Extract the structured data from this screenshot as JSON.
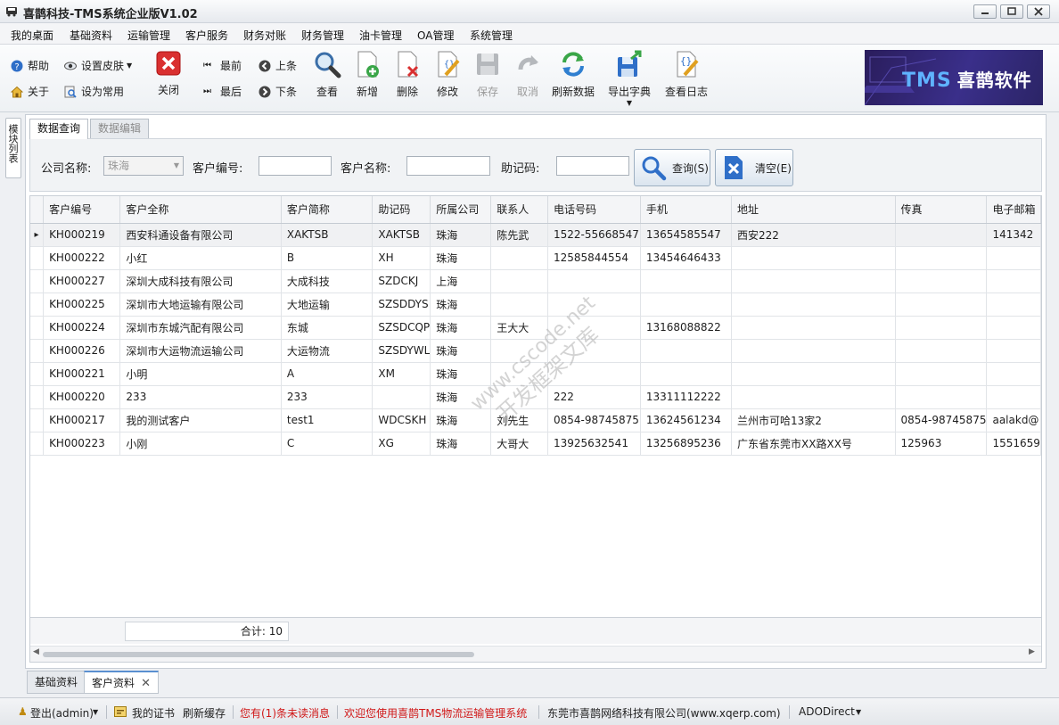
{
  "window": {
    "title": "喜鹊科技-TMS系统企业版V1.02"
  },
  "menu": [
    "我的桌面",
    "基础资料",
    "运输管理",
    "客户服务",
    "财务对账",
    "财务管理",
    "油卡管理",
    "OA管理",
    "系统管理"
  ],
  "toolbar": {
    "help": "帮助",
    "skin": "设置皮肤",
    "about": "关于",
    "set_common": "设为常用",
    "close": "关闭",
    "first": "最前",
    "prev": "上条",
    "last": "最后",
    "next": "下条",
    "view": "查看",
    "add": "新增",
    "delete": "删除",
    "edit": "修改",
    "save": "保存",
    "cancel": "取消",
    "refresh": "刷新数据",
    "export_dict": "导出字典",
    "view_log": "查看日志"
  },
  "banner": {
    "tms": "TMS",
    "text": "喜鹊软件"
  },
  "side_tab": "模块列表",
  "tabs": {
    "query": "数据查询",
    "edit": "数据编辑"
  },
  "filter": {
    "company_label": "公司名称:",
    "company_value": "珠海",
    "code_label": "客户编号:",
    "code_value": "",
    "name_label": "客户名称:",
    "name_value": "",
    "mnemonic_label": "助记码:",
    "mnemonic_value": "",
    "query_btn": "查询(S)",
    "clear_btn": "清空(E)"
  },
  "grid": {
    "columns": [
      "客户编号",
      "客户全称",
      "客户简称",
      "助记码",
      "所属公司",
      "联系人",
      "电话号码",
      "手机",
      "地址",
      "传真",
      "电子邮箱"
    ],
    "rows": [
      [
        "KH000219",
        "西安科通设备有限公司",
        "XAKTSB",
        "XAKTSB",
        "珠海",
        "陈先武",
        "1522-55668547",
        "13654585547",
        "西安222",
        "",
        "141342"
      ],
      [
        "KH000222",
        "小红",
        "B",
        "XH",
        "珠海",
        "",
        "12585844554",
        "13454646433",
        "",
        "",
        ""
      ],
      [
        "KH000227",
        "深圳大成科技有限公司",
        "大成科技",
        "SZDCKJ",
        "上海",
        "",
        "",
        "",
        "",
        "",
        ""
      ],
      [
        "KH000225",
        "深圳市大地运输有限公司",
        "大地运输",
        "SZSDDYS",
        "珠海",
        "",
        "",
        "",
        "",
        "",
        ""
      ],
      [
        "KH000224",
        "深圳市东城汽配有限公司",
        "东城",
        "SZSDCQP",
        "珠海",
        "王大大",
        "",
        "13168088822",
        "",
        "",
        ""
      ],
      [
        "KH000226",
        "深圳市大运物流运输公司",
        "大运物流",
        "SZSDYWL",
        "珠海",
        "",
        "",
        "",
        "",
        "",
        ""
      ],
      [
        "KH000221",
        "小明",
        "A",
        "XM",
        "珠海",
        "",
        "",
        "",
        "",
        "",
        ""
      ],
      [
        "KH000220",
        "233",
        "233",
        "",
        "珠海",
        "",
        "222",
        "13311112222",
        "",
        "",
        ""
      ],
      [
        "KH000217",
        "我的测试客户",
        "test1",
        "WDCSKH",
        "珠海",
        "刘先生",
        "0854-98745875",
        "13624561234",
        "兰州市可哈13家2",
        "0854-98745875",
        "aalakd@"
      ],
      [
        "KH000223",
        "小刚",
        "C",
        "XG",
        "珠海",
        "大哥大",
        "13925632541",
        "13256895236",
        "广东省东莞市XX路XX号",
        "125963",
        "1551659"
      ]
    ],
    "total_label": "合计:",
    "total_value": "10"
  },
  "watermark": {
    "line1": "www.cscode.net",
    "line2": "开发框架文库"
  },
  "bottom_tabs": [
    "基础资料",
    "客户资料"
  ],
  "status": {
    "logout": "登出(admin)",
    "cert": "我的证书",
    "refresh_cache": "刷新缓存",
    "unread": "您有(1)条未读消息",
    "welcome": "欢迎您使用喜鹊TMS物流运输管理系统",
    "company": "东莞市喜鹊网络科技有限公司(www.xqerp.com)",
    "db": "ADODirect"
  },
  "colors": {
    "accent": "#5a8fd0",
    "danger": "#d01818",
    "close_red": "#d93030"
  }
}
